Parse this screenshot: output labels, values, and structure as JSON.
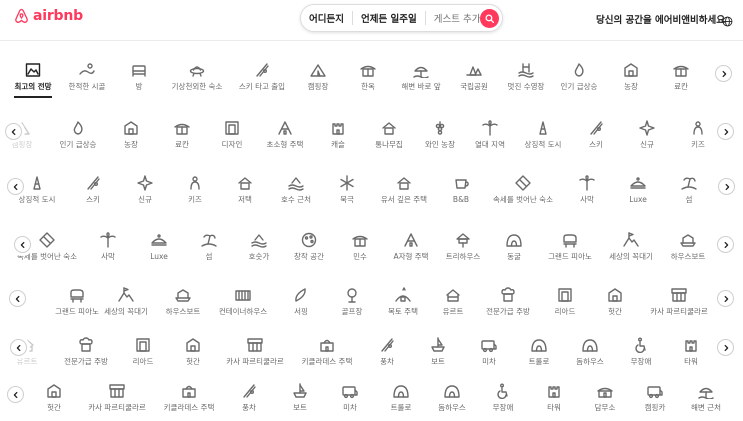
{
  "header": {
    "brand": "airbnb",
    "search": {
      "where": "어디든지",
      "when": "언제든 일주일",
      "guests": "게스트 추가"
    },
    "host_link": "당신의 공간을 에어비앤비하세요"
  },
  "rows": [
    {
      "items": [
        {
          "label": "최고의 전망",
          "icon": "view-icon",
          "active": true
        },
        {
          "label": "한적한 시골",
          "icon": "countryside-icon"
        },
        {
          "label": "방",
          "icon": "bed-icon"
        },
        {
          "label": "기상천외한 숙소",
          "icon": "ufo-icon"
        },
        {
          "label": "스키 타고 출입",
          "icon": "ski-icon"
        },
        {
          "label": "캠핑장",
          "icon": "tent-icon"
        },
        {
          "label": "한옥",
          "icon": "hanok-icon"
        },
        {
          "label": "해변 바로 앞",
          "icon": "beach-icon"
        },
        {
          "label": "국립공원",
          "icon": "park-icon"
        },
        {
          "label": "멋진 수영장",
          "icon": "pool-icon"
        },
        {
          "label": "인기 급상승",
          "icon": "flame-icon"
        },
        {
          "label": "농장",
          "icon": "farm-icon"
        },
        {
          "label": "료칸",
          "icon": "ryokan-icon"
        }
      ]
    },
    {
      "items": [
        {
          "label": "캠핑장",
          "icon": "tent-icon"
        },
        {
          "label": "인기 급상승",
          "icon": "flame-icon"
        },
        {
          "label": "농장",
          "icon": "farm-icon"
        },
        {
          "label": "료칸",
          "icon": "ryokan-icon"
        },
        {
          "label": "디자인",
          "icon": "design-icon"
        },
        {
          "label": "초소형 주택",
          "icon": "tiny-house-icon"
        },
        {
          "label": "캐슬",
          "icon": "castle-icon"
        },
        {
          "label": "통나무집",
          "icon": "cabin-icon"
        },
        {
          "label": "와인 농장",
          "icon": "vineyard-icon"
        },
        {
          "label": "열대 지역",
          "icon": "tropical-icon"
        },
        {
          "label": "상징적 도시",
          "icon": "iconic-city-icon"
        },
        {
          "label": "스키",
          "icon": "ski-icon"
        },
        {
          "label": "신규",
          "icon": "new-icon"
        },
        {
          "label": "키즈",
          "icon": "kids-icon"
        }
      ]
    },
    {
      "items": [
        {
          "label": "상징적 도시",
          "icon": "iconic-city-icon"
        },
        {
          "label": "스키",
          "icon": "ski-icon"
        },
        {
          "label": "신규",
          "icon": "new-icon"
        },
        {
          "label": "키즈",
          "icon": "kids-icon"
        },
        {
          "label": "저택",
          "icon": "mansion-icon"
        },
        {
          "label": "호수 근처",
          "icon": "lake-icon"
        },
        {
          "label": "북극",
          "icon": "arctic-icon"
        },
        {
          "label": "유서 깊은 주택",
          "icon": "historic-icon"
        },
        {
          "label": "B&B",
          "icon": "bnb-icon"
        },
        {
          "label": "속세를 벗어난 숙소",
          "icon": "off-grid-icon"
        },
        {
          "label": "사막",
          "icon": "desert-icon"
        },
        {
          "label": "Luxe",
          "icon": "luxe-icon"
        },
        {
          "label": "섬",
          "icon": "island-icon"
        }
      ]
    },
    {
      "items": [
        {
          "label": "속세를 벗어난 숙소",
          "icon": "off-grid-icon"
        },
        {
          "label": "사막",
          "icon": "desert-icon"
        },
        {
          "label": "Luxe",
          "icon": "luxe-icon"
        },
        {
          "label": "섬",
          "icon": "island-icon"
        },
        {
          "label": "호숫가",
          "icon": "lakefront-icon"
        },
        {
          "label": "창작 공간",
          "icon": "creative-icon"
        },
        {
          "label": "민수",
          "icon": "minsu-icon"
        },
        {
          "label": "A자형 주택",
          "icon": "a-frame-icon"
        },
        {
          "label": "트리하우스",
          "icon": "treehouse-icon"
        },
        {
          "label": "동굴",
          "icon": "cave-icon"
        },
        {
          "label": "그랜드 피아노",
          "icon": "piano-icon"
        },
        {
          "label": "세상의 꼭대기",
          "icon": "top-of-world-icon"
        },
        {
          "label": "하우스보트",
          "icon": "houseboat-icon"
        }
      ]
    },
    {
      "items": [
        {
          "label": "그랜드 피아노",
          "icon": "piano-icon"
        },
        {
          "label": "세상의 꼭대기",
          "icon": "top-of-world-icon"
        },
        {
          "label": "하우스보트",
          "icon": "houseboat-icon"
        },
        {
          "label": "컨테이너하우스",
          "icon": "container-icon"
        },
        {
          "label": "서핑",
          "icon": "surf-icon"
        },
        {
          "label": "골프장",
          "icon": "golf-icon"
        },
        {
          "label": "복토 주택",
          "icon": "earth-home-icon"
        },
        {
          "label": "유르트",
          "icon": "yurt-icon"
        },
        {
          "label": "전문가급 주방",
          "icon": "kitchen-icon"
        },
        {
          "label": "리아드",
          "icon": "riad-icon"
        },
        {
          "label": "헛간",
          "icon": "barn-icon"
        },
        {
          "label": "카사 파르티쿨라르",
          "icon": "casa-icon"
        }
      ]
    },
    {
      "items": [
        {
          "label": "유르트",
          "icon": "yurt-icon"
        },
        {
          "label": "전문가급 주방",
          "icon": "kitchen-icon"
        },
        {
          "label": "리아드",
          "icon": "riad-icon"
        },
        {
          "label": "헛간",
          "icon": "barn-icon"
        },
        {
          "label": "카사 파르티쿨라르",
          "icon": "casa-icon"
        },
        {
          "label": "키클라데스 주택",
          "icon": "cycladic-icon"
        },
        {
          "label": "풍차",
          "icon": "windmill-icon"
        },
        {
          "label": "보트",
          "icon": "boat-icon"
        },
        {
          "label": "미차",
          "icon": "camper-icon"
        },
        {
          "label": "트룰로",
          "icon": "trullo-icon"
        },
        {
          "label": "돔하우스",
          "icon": "dome-icon"
        },
        {
          "label": "무장애",
          "icon": "accessible-icon"
        },
        {
          "label": "타워",
          "icon": "tower-icon"
        }
      ]
    },
    {
      "items": [
        {
          "label": "헛간",
          "icon": "barn-icon"
        },
        {
          "label": "카사 파르티쿨라르",
          "icon": "casa-icon"
        },
        {
          "label": "키클라데스 주택",
          "icon": "cycladic-icon"
        },
        {
          "label": "풍차",
          "icon": "windmill-icon"
        },
        {
          "label": "보트",
          "icon": "boat-icon"
        },
        {
          "label": "미차",
          "icon": "camper-icon"
        },
        {
          "label": "트룰로",
          "icon": "trullo-icon"
        },
        {
          "label": "돔하우스",
          "icon": "dome-icon"
        },
        {
          "label": "무장애",
          "icon": "accessible-icon"
        },
        {
          "label": "타워",
          "icon": "tower-icon"
        },
        {
          "label": "담무소",
          "icon": "dammuso-icon"
        },
        {
          "label": "캠핑카",
          "icon": "rv-icon"
        },
        {
          "label": "해변 근처",
          "icon": "beachfront-icon"
        }
      ]
    }
  ]
}
